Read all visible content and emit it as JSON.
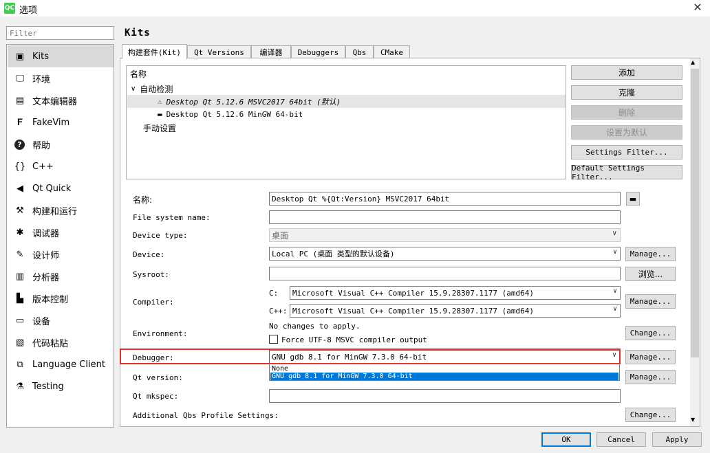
{
  "window": {
    "title": "选项",
    "app_icon": "QC",
    "close": "✕"
  },
  "filter": {
    "placeholder": "Filter"
  },
  "sidebar": {
    "items": [
      {
        "label": "Kits",
        "icon": "kits-icon",
        "glyph": "▣"
      },
      {
        "label": "环境",
        "icon": "monitor-icon",
        "glyph": "🖵"
      },
      {
        "label": "文本编辑器",
        "icon": "text-editor-icon",
        "glyph": "▤"
      },
      {
        "label": "FakeVim",
        "icon": "fakevim-icon",
        "glyph": "𝐅"
      },
      {
        "label": "帮助",
        "icon": "help-icon",
        "glyph": "?"
      },
      {
        "label": "C++",
        "icon": "braces-icon",
        "glyph": "{}"
      },
      {
        "label": "Qt Quick",
        "icon": "qt-quick-icon",
        "glyph": "◀"
      },
      {
        "label": "构建和运行",
        "icon": "hammer-icon",
        "glyph": "⚒"
      },
      {
        "label": "调试器",
        "icon": "bug-icon",
        "glyph": "✱"
      },
      {
        "label": "设计师",
        "icon": "pen-icon",
        "glyph": "✎"
      },
      {
        "label": "分析器",
        "icon": "analyzer-icon",
        "glyph": "▥"
      },
      {
        "label": "版本控制",
        "icon": "version-control-icon",
        "glyph": "▙"
      },
      {
        "label": "设备",
        "icon": "device-icon",
        "glyph": "▭"
      },
      {
        "label": "代码粘贴",
        "icon": "clipboard-icon",
        "glyph": "▧"
      },
      {
        "label": "Language Client",
        "icon": "language-client-icon",
        "glyph": "⧉"
      },
      {
        "label": "Testing",
        "icon": "testing-icon",
        "glyph": "⚗"
      }
    ]
  },
  "page": {
    "title": "Kits"
  },
  "tabs": [
    "构建套件(Kit)",
    "Qt Versions",
    "编译器",
    "Debuggers",
    "Qbs",
    "CMake"
  ],
  "tree": {
    "header": "名称",
    "auto_group": "自动检测",
    "kit1": "Desktop Qt 5.12.6 MSVC2017 64bit (默认)",
    "kit2": "Desktop Qt 5.12.6 MinGW 64-bit",
    "manual_group": "手动设置"
  },
  "kit_buttons": {
    "add": "添加",
    "clone": "克隆",
    "delete": "删除",
    "set_default": "设置为默认",
    "settings_filter": "Settings Filter...",
    "default_settings_filter": "Default Settings Filter..."
  },
  "form": {
    "name_label": "名称:",
    "name_value": "Desktop Qt %{Qt:Version} MSVC2017 64bit",
    "fs_label": "File system name:",
    "device_type_label": "Device type:",
    "device_type_value": "桌面",
    "device_label": "Device:",
    "device_value": "Local PC (桌面 类型的默认设备)",
    "device_manage": "Manage...",
    "sysroot_label": "Sysroot:",
    "sysroot_browse": "浏览...",
    "compiler_label": "Compiler:",
    "compiler_c_label": "C:",
    "compiler_c_value": "Microsoft Visual C++ Compiler 15.9.28307.1177 (amd64)",
    "compiler_cpp_label": "C++:",
    "compiler_cpp_value": "Microsoft Visual C++ Compiler 15.9.28307.1177 (amd64)",
    "compiler_manage": "Manage...",
    "env_label": "Environment:",
    "env_text": "No changes to apply.",
    "env_checkbox": "Force UTF-8 MSVC compiler output",
    "env_change": "Change...",
    "debugger_label": "Debugger:",
    "debugger_value": "GNU gdb 8.1 for MinGW 7.3.0 64-bit",
    "debugger_manage": "Manage...",
    "debugger_options": [
      "None",
      "GNU gdb 8.1 for MinGW 7.3.0 64-bit"
    ],
    "qt_version_label": "Qt version:",
    "qt_version_manage": "Manage...",
    "qt_mkspec_label": "Qt mkspec:",
    "qbs_label": "Additional Qbs Profile Settings:",
    "qbs_change": "Change..."
  },
  "dialog_buttons": {
    "ok": "OK",
    "cancel": "Cancel",
    "apply": "Apply"
  },
  "colors": {
    "highlight_border": "#e0302a",
    "selection": "#0078d7",
    "qt_green": "#41cd52"
  }
}
